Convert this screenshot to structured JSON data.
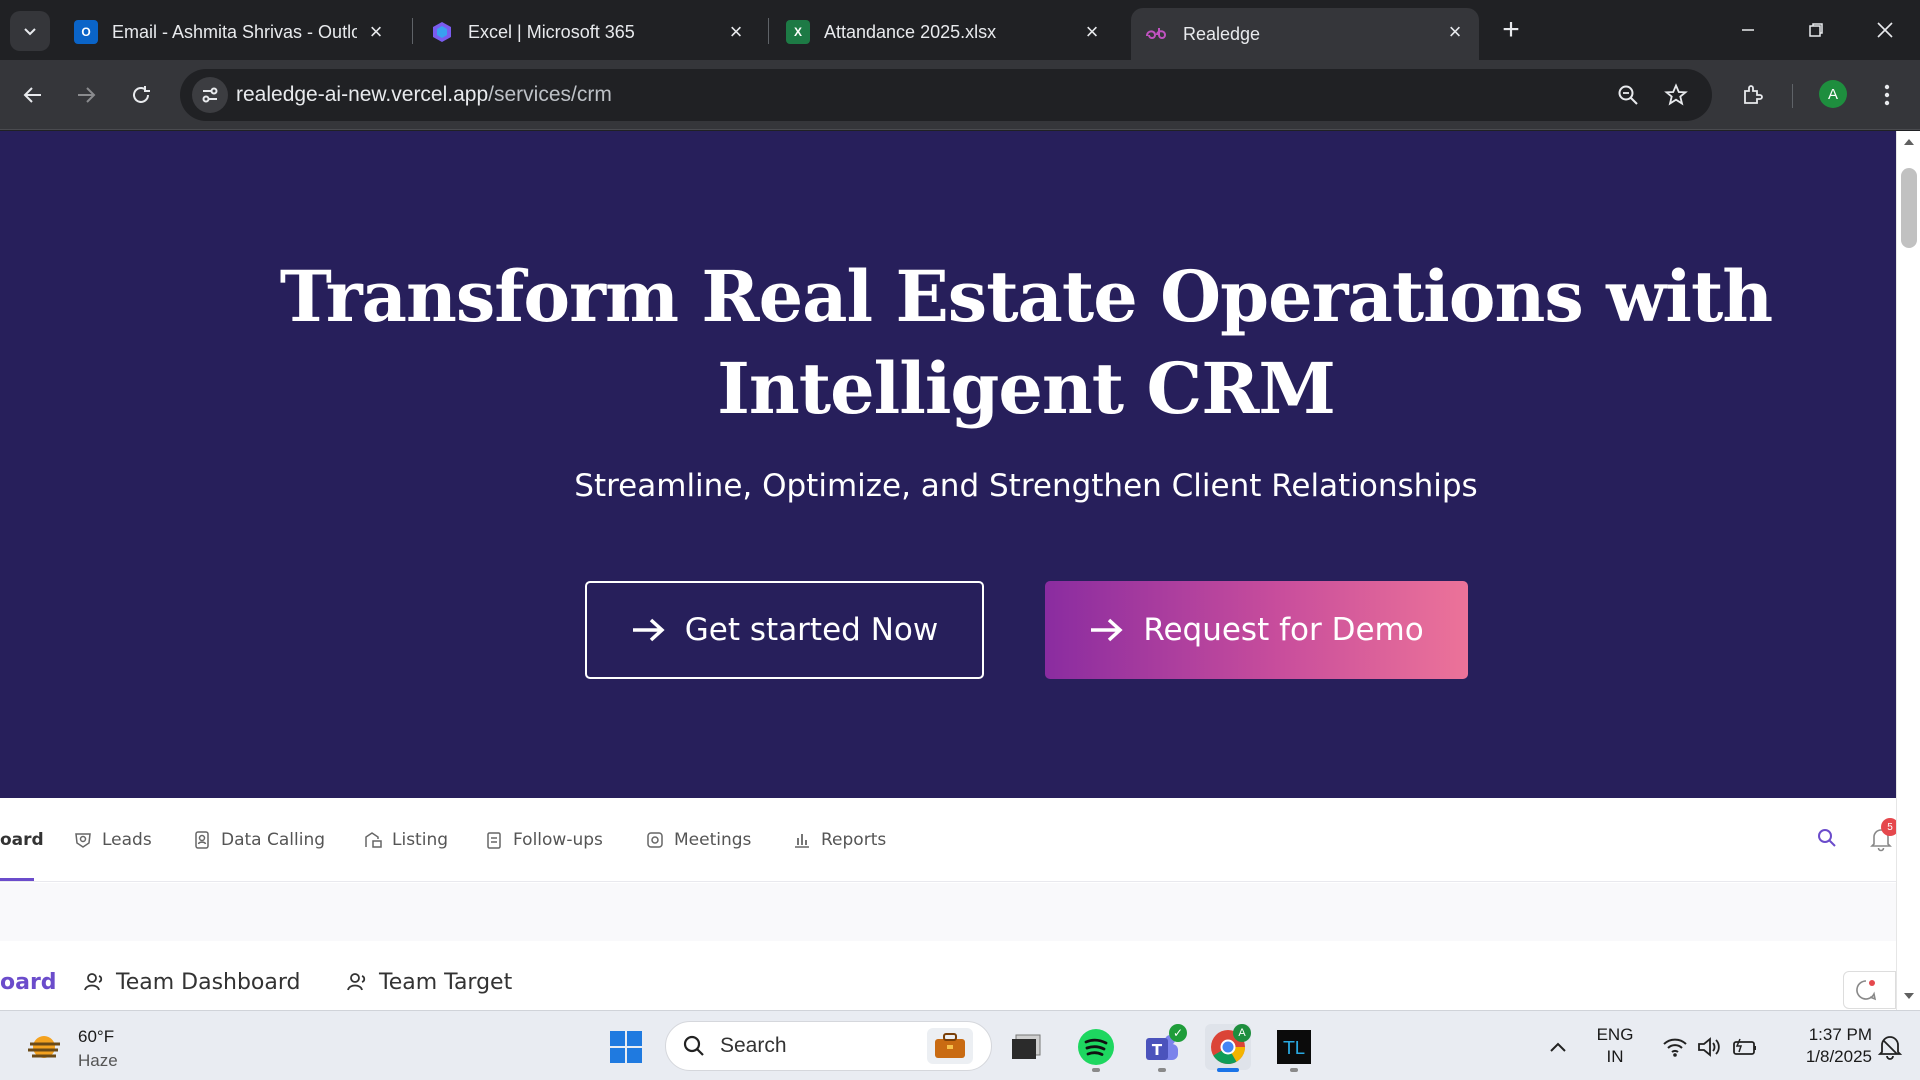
{
  "browser": {
    "tabs": [
      {
        "title": "Email - Ashmita Shrivas - Outlook",
        "icon": "outlook-icon",
        "active": false
      },
      {
        "title": "Excel | Microsoft 365",
        "icon": "microsoft365-icon",
        "active": false
      },
      {
        "title": "Attandance 2025.xlsx",
        "icon": "excel-icon",
        "active": false
      },
      {
        "title": "Realedge",
        "icon": "realedge-icon",
        "active": true
      }
    ],
    "address": {
      "host": "realedge-ai-new.vercel.app",
      "path": "/services/crm"
    },
    "profile_initial": "A"
  },
  "hero": {
    "title_line1": "Transform Real Estate Operations with",
    "title_line2": "Intelligent CRM",
    "subtitle": "Streamline, Optimize, and Strengthen Client Relationships",
    "primary_button": "Get started Now",
    "secondary_button": "Request for Demo",
    "background_color": "#271f5b",
    "accent_gradient": [
      "#8a2ca0",
      "#ec7399"
    ]
  },
  "crm_preview": {
    "nav": [
      "oard",
      "Leads",
      "Data Calling",
      "Listing",
      "Follow-ups",
      "Meetings",
      "Reports"
    ],
    "notification_count": "5",
    "subnav": [
      "oard",
      "Team Dashboard",
      "Team Target"
    ]
  },
  "taskbar": {
    "weather_temp": "60°F",
    "weather_condition": "Haze",
    "search_label": "Search",
    "language": "ENG",
    "region": "IN",
    "time": "1:37 PM",
    "date": "1/8/2025",
    "teams_badge": "✓",
    "chrome_badge": "A"
  }
}
